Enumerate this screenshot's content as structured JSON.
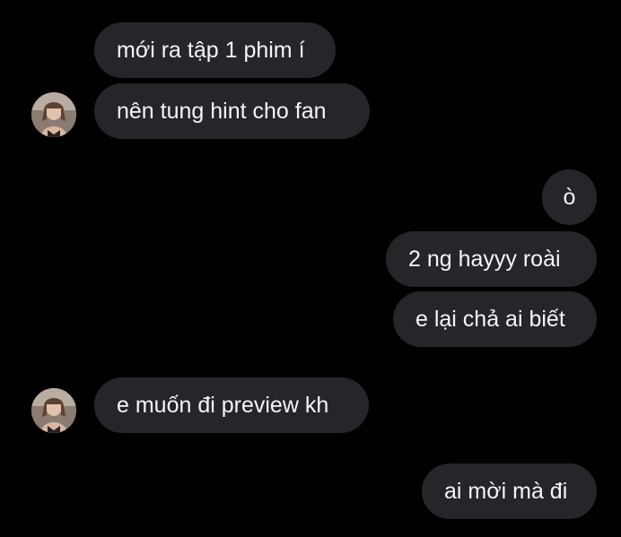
{
  "messages": [
    {
      "id": "m1",
      "side": "received",
      "text": "mới ra tập 1 phim í"
    },
    {
      "id": "m2",
      "side": "received",
      "text": "nên tung hint cho fan"
    },
    {
      "id": "m3",
      "side": "sent",
      "text": "ò"
    },
    {
      "id": "m4",
      "side": "sent",
      "text": "2 ng hayyy roài"
    },
    {
      "id": "m5",
      "side": "sent",
      "text": "e lại chả ai biết"
    },
    {
      "id": "m6",
      "side": "received",
      "text": "e muốn đi preview kh"
    },
    {
      "id": "m7",
      "side": "sent",
      "text": "ai mời mà đi"
    }
  ],
  "colors": {
    "background": "#000000",
    "bubble": "#26252a",
    "text": "#f5f5f7"
  },
  "icons": {
    "avatar": "contact-avatar-photo"
  }
}
